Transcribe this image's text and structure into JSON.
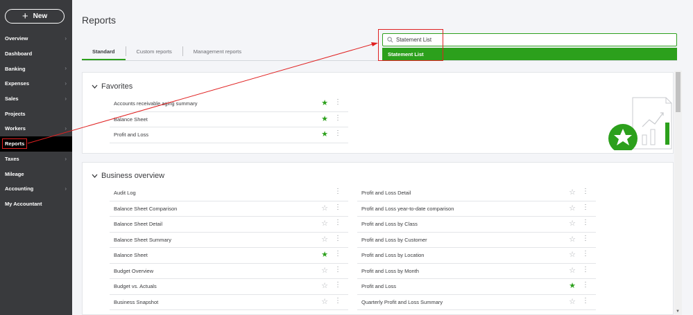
{
  "sidebar": {
    "new_label": "New",
    "items": [
      {
        "label": "Overview",
        "chevron": true
      },
      {
        "label": "Dashboard",
        "chevron": false
      },
      {
        "label": "Banking",
        "chevron": true
      },
      {
        "label": "Expenses",
        "chevron": true
      },
      {
        "label": "Sales",
        "chevron": true
      },
      {
        "label": "Projects",
        "chevron": false
      },
      {
        "label": "Workers",
        "chevron": true
      },
      {
        "label": "Reports",
        "chevron": false,
        "active": true
      },
      {
        "label": "Taxes",
        "chevron": true
      },
      {
        "label": "Mileage",
        "chevron": false
      },
      {
        "label": "Accounting",
        "chevron": true
      },
      {
        "label": "My Accountant",
        "chevron": false
      }
    ]
  },
  "page": {
    "title": "Reports"
  },
  "tabs": [
    {
      "label": "Standard",
      "active": true
    },
    {
      "label": "Custom reports",
      "active": false
    },
    {
      "label": "Management reports",
      "active": false
    }
  ],
  "search": {
    "value": "Statement List",
    "suggestion": "Statement List"
  },
  "favorites": {
    "title": "Favorites",
    "items": [
      {
        "label": "Accounts receivable aging summary",
        "favorite": true
      },
      {
        "label": "Balance Sheet",
        "favorite": true
      },
      {
        "label": "Profit and Loss",
        "favorite": true
      }
    ]
  },
  "business_overview": {
    "title": "Business overview",
    "left": [
      {
        "label": "Audit Log",
        "favorite": null
      },
      {
        "label": "Balance Sheet Comparison",
        "favorite": false
      },
      {
        "label": "Balance Sheet Detail",
        "favorite": false
      },
      {
        "label": "Balance Sheet Summary",
        "favorite": false
      },
      {
        "label": "Balance Sheet",
        "favorite": true
      },
      {
        "label": "Budget Overview",
        "favorite": false
      },
      {
        "label": "Budget vs. Actuals",
        "favorite": false
      },
      {
        "label": "Business Snapshot",
        "favorite": false
      }
    ],
    "right": [
      {
        "label": "Profit and Loss Detail",
        "favorite": false
      },
      {
        "label": "Profit and Loss year-to-date comparison",
        "favorite": false
      },
      {
        "label": "Profit and Loss by Class",
        "favorite": false
      },
      {
        "label": "Profit and Loss by Customer",
        "favorite": false
      },
      {
        "label": "Profit and Loss by Location",
        "favorite": false
      },
      {
        "label": "Profit and Loss by Month",
        "favorite": false
      },
      {
        "label": "Profit and Loss",
        "favorite": true
      },
      {
        "label": "Quarterly Profit and Loss Summary",
        "favorite": false
      }
    ]
  },
  "colors": {
    "accent": "#2ca01c",
    "sidebar": "#393a3d",
    "annotation": "#e02020"
  }
}
